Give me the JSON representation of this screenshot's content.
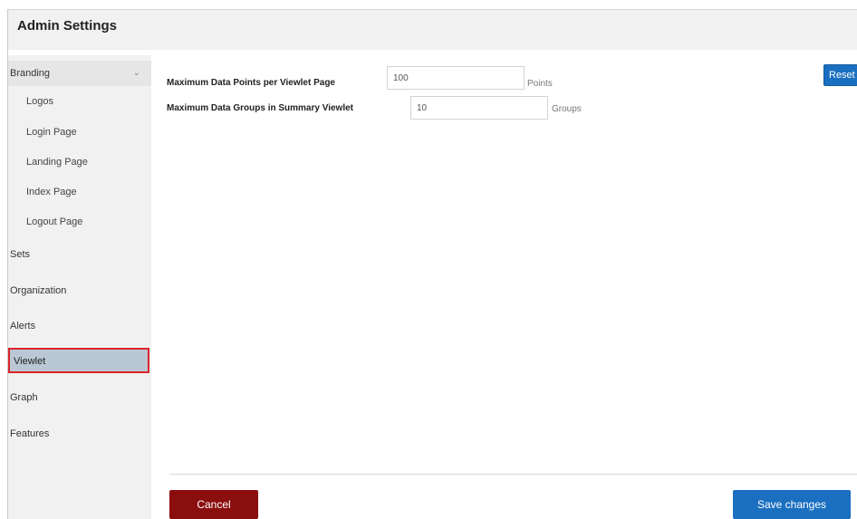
{
  "header": {
    "title": "Admin Settings"
  },
  "sidebar": {
    "branding": {
      "label": "Branding",
      "chevron": "⌄"
    },
    "branding_items": [
      "Logos",
      "Login Page",
      "Landing Page",
      "Index Page",
      "Logout Page"
    ],
    "items": [
      "Sets",
      "Organization",
      "Alerts",
      "Viewlet",
      "Graph",
      "Features"
    ],
    "selected": "Viewlet"
  },
  "form": {
    "row1": {
      "label": "Maximum Data Points per Viewlet Page",
      "value": "100",
      "unit": "Points"
    },
    "row2": {
      "label": "Maximum Data Groups in Summary Viewlet",
      "value": "10",
      "unit": "Groups"
    }
  },
  "buttons": {
    "reset": "Reset",
    "cancel": "Cancel",
    "save": "Save changes"
  },
  "colors": {
    "primary": "#1a6fc0",
    "cancel": "#8b0e0e",
    "selected_border": "#d9252a",
    "selected_bg": "#b9c8d4"
  }
}
